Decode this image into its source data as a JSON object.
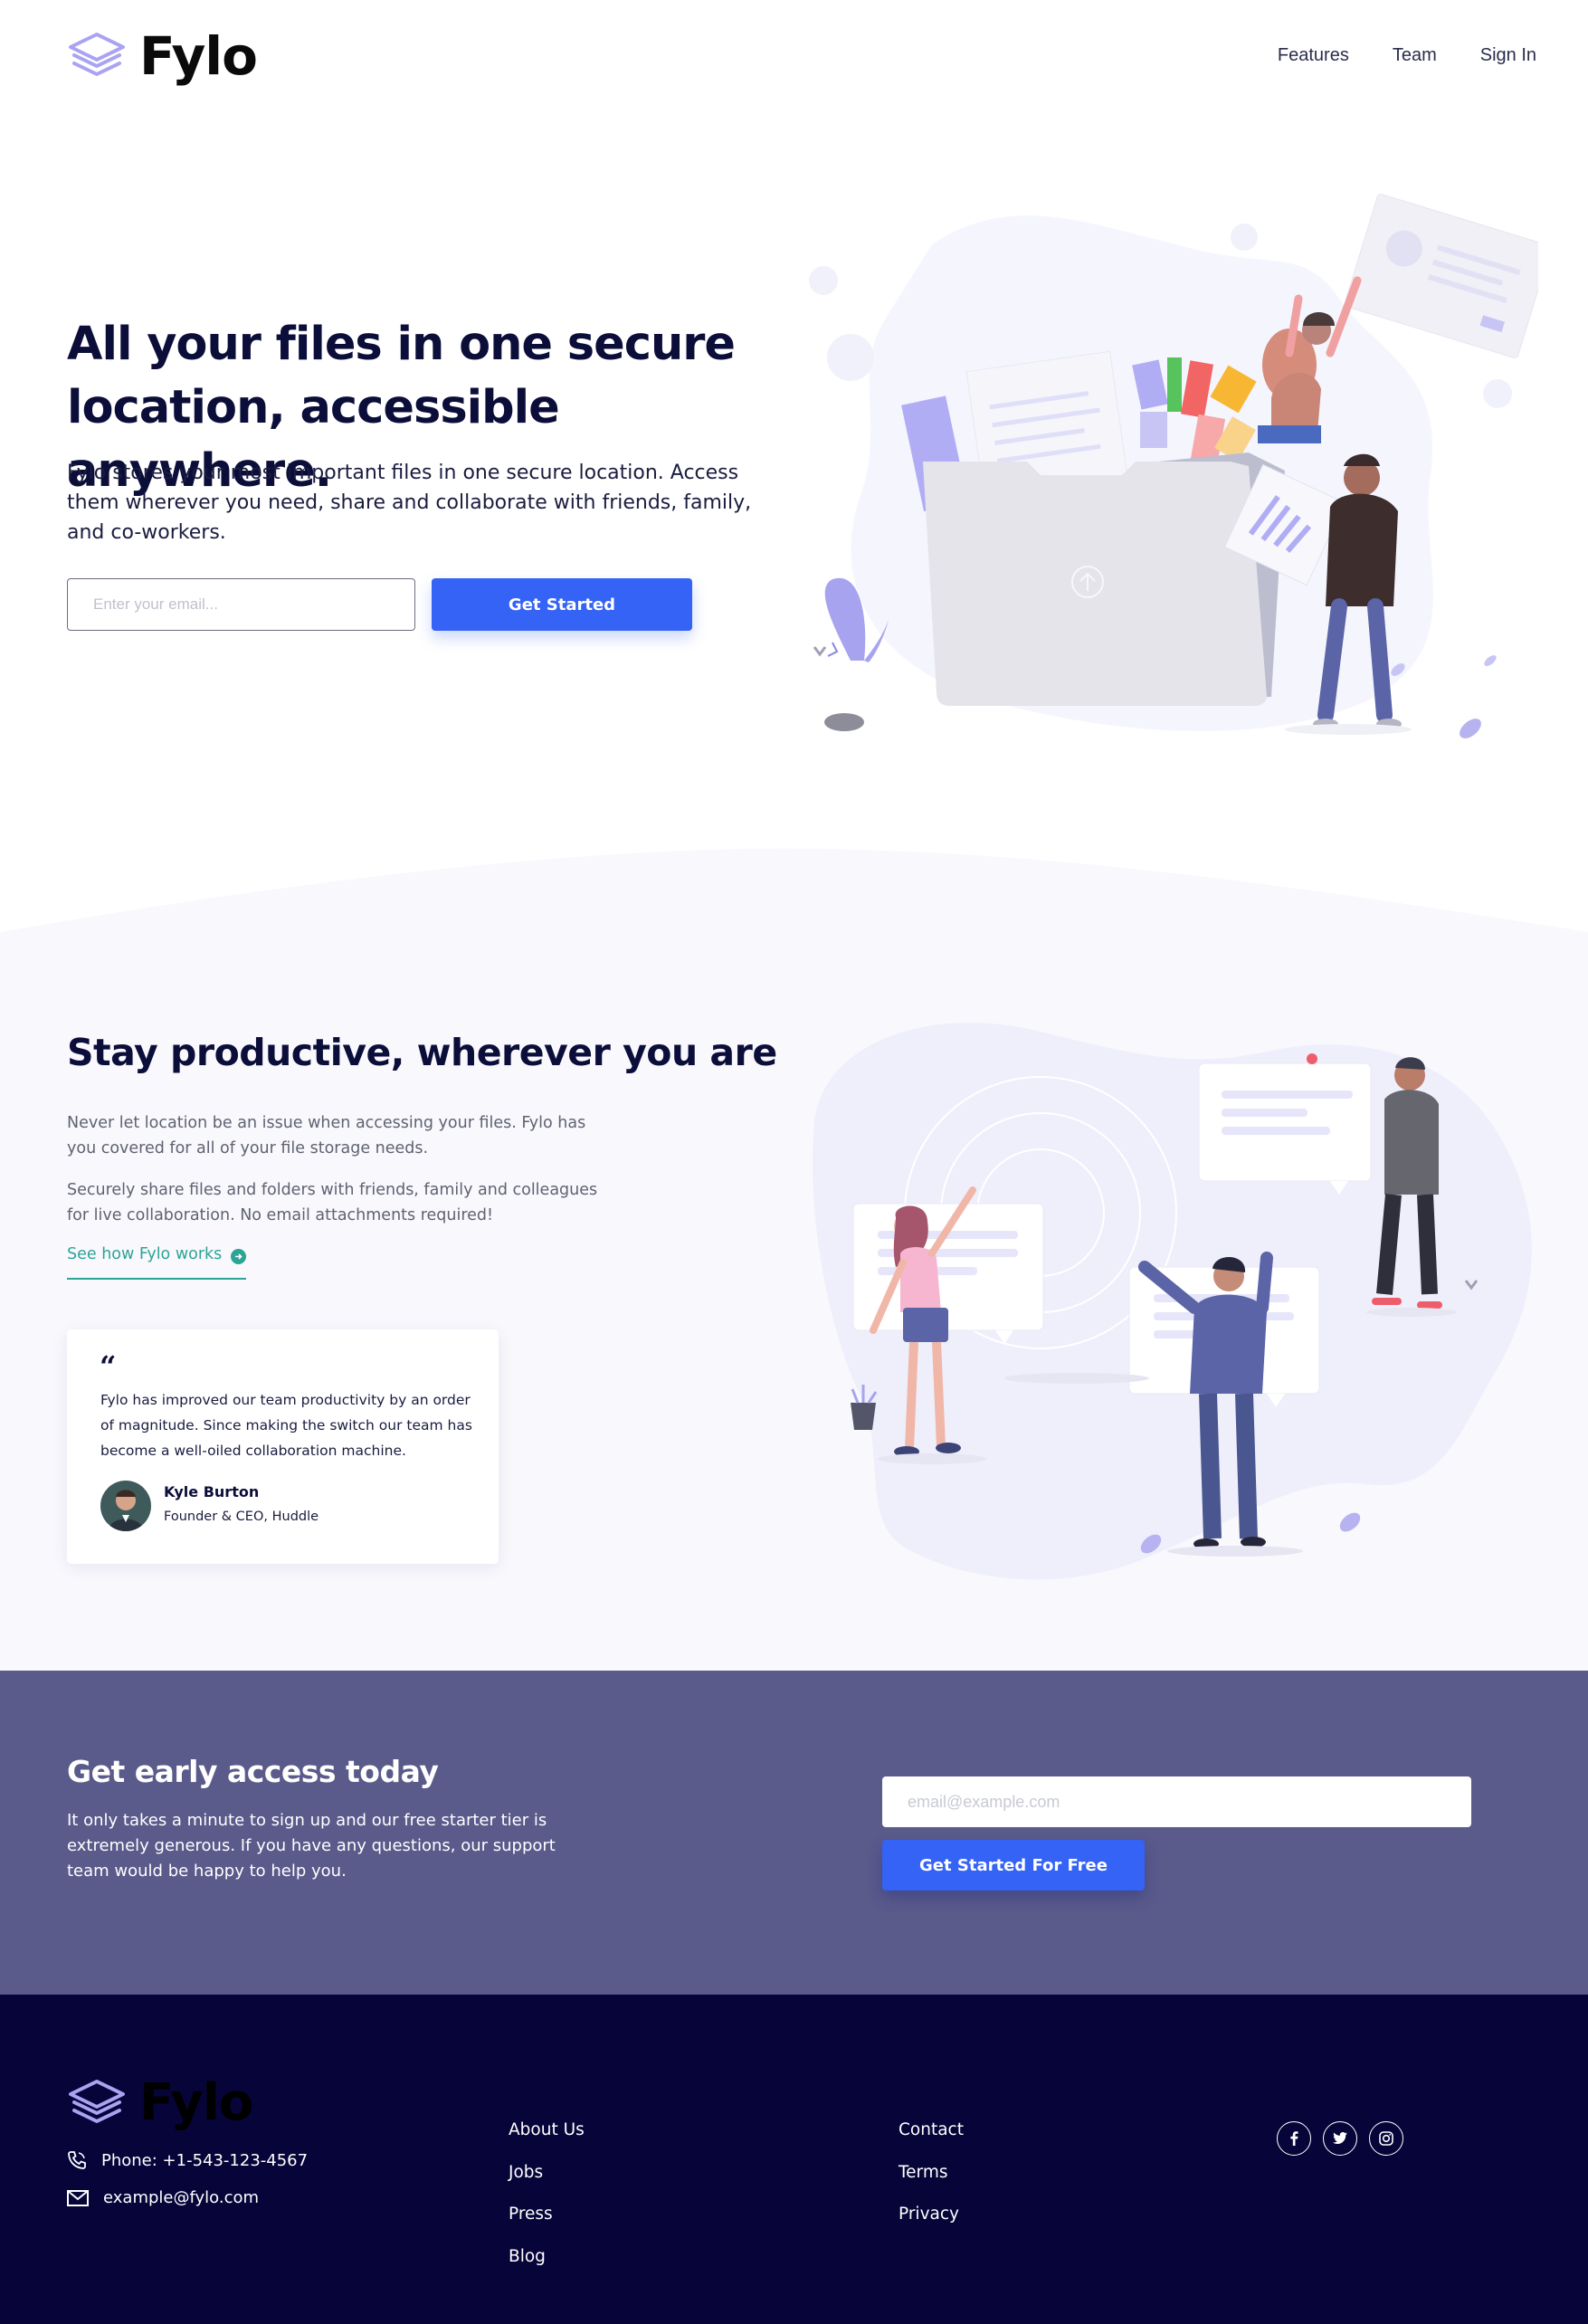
{
  "brand": {
    "name": "Fylo"
  },
  "nav": {
    "links": [
      "Features",
      "Team",
      "Sign In"
    ]
  },
  "hero": {
    "title": "All your files in one secure location, accessible anywhere.",
    "description": "Fylo stores your most important files in one secure location. Access them wherever you need, share and collaborate with friends, family, and co-workers.",
    "email_placeholder": "Enter your email...",
    "button_label": "Get Started"
  },
  "productive": {
    "title": "Stay productive, wherever you are",
    "paragraph1": "Never let location be an issue when accessing your files. Fylo has you covered for all of your file storage needs.",
    "paragraph2": "Securely share files and folders with friends, family and colleagues for live collaboration. No email attachments required!",
    "link_label": "See how Fylo works",
    "testimonial": {
      "quote_mark": "“",
      "text": "Fylo has improved our team productivity by an order of magnitude. Since making the switch our team has become a well-oiled collaboration machine.",
      "name": "Kyle Burton",
      "role": "Founder & CEO, Huddle"
    }
  },
  "cta": {
    "title": "Get early access today",
    "description": "It only takes a minute to sign up and our free starter tier is extremely generous. If you have any questions, our support team would be happy to help you.",
    "email_placeholder": "email@example.com",
    "button_label": "Get Started For Free"
  },
  "footer": {
    "phone": "Phone: +1-543-123-4567",
    "email": "example@fylo.com",
    "column1": [
      "About Us",
      "Jobs",
      "Press",
      "Blog"
    ],
    "column2": [
      "Contact",
      "Terms",
      "Privacy"
    ],
    "social": [
      "facebook-icon",
      "twitter-icon",
      "instagram-icon"
    ]
  },
  "colors": {
    "accent_blue": "#3463f5",
    "cta_bg": "#5a5a8b",
    "footer_bg": "#070439",
    "link_teal": "#2ea495",
    "heading_navy": "#0c0e3a"
  }
}
